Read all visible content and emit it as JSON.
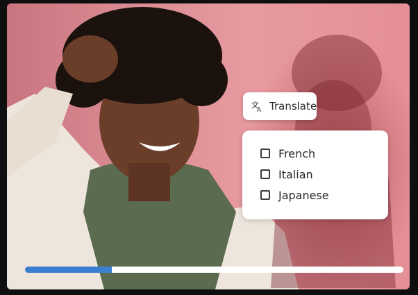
{
  "translate_button": {
    "label": "Translate",
    "icon": "translate-icon"
  },
  "language_menu": {
    "options": [
      {
        "label": "French",
        "checked": false
      },
      {
        "label": "Italian",
        "checked": false
      },
      {
        "label": "Japanese",
        "checked": false
      }
    ]
  },
  "video_progress": {
    "fraction": 0.23,
    "fill_color": "#3b7fd1",
    "track_color": "#ffffff"
  },
  "colors": {
    "background": "#e28f96"
  }
}
